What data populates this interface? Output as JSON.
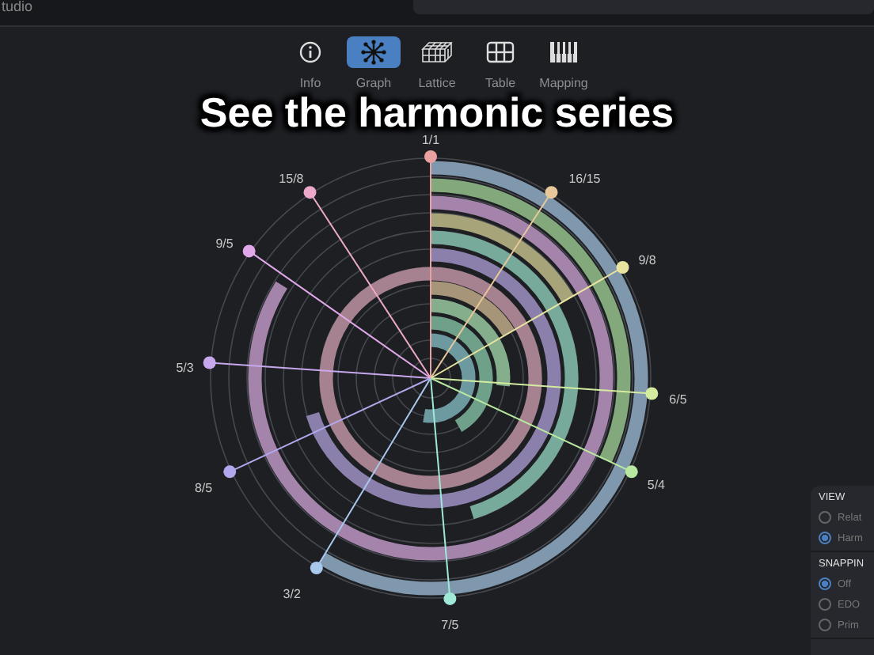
{
  "app": {
    "title": "tudio"
  },
  "toolbar": {
    "tabs": [
      {
        "label": "Info",
        "kind": "info",
        "selected": false
      },
      {
        "label": "Graph",
        "kind": "graph",
        "selected": true
      },
      {
        "label": "Lattice",
        "kind": "lattice",
        "selected": false
      },
      {
        "label": "Table",
        "kind": "table",
        "selected": false
      },
      {
        "label": "Mapping",
        "kind": "mapping",
        "selected": false
      }
    ]
  },
  "caption": "See the harmonic series",
  "graph": {
    "intervals": [
      {
        "label": "1/1",
        "color": "#e8a0a0"
      },
      {
        "label": "16/15",
        "color": "#e8c89a"
      },
      {
        "label": "9/8",
        "color": "#e8e4a0"
      },
      {
        "label": "6/5",
        "color": "#d4eca0"
      },
      {
        "label": "5/4",
        "color": "#b8e8a0"
      },
      {
        "label": "7/5",
        "color": "#a0e8d8"
      },
      {
        "label": "3/2",
        "color": "#a8c8ec"
      },
      {
        "label": "8/5",
        "color": "#b0a8ec"
      },
      {
        "label": "5/3",
        "color": "#c8a8ec"
      },
      {
        "label": "9/5",
        "color": "#e0a8e8"
      },
      {
        "label": "15/8",
        "color": "#eca8c8"
      }
    ]
  },
  "panel": {
    "sections": [
      {
        "title": "VIEW",
        "options": [
          {
            "label": "Relat",
            "selected": false
          },
          {
            "label": "Harm",
            "selected": true
          }
        ]
      },
      {
        "title": "SNAPPIN",
        "options": [
          {
            "label": "Off",
            "selected": true
          },
          {
            "label": "EDO",
            "selected": false
          },
          {
            "label": "Prim",
            "selected": false
          }
        ]
      }
    ]
  }
}
